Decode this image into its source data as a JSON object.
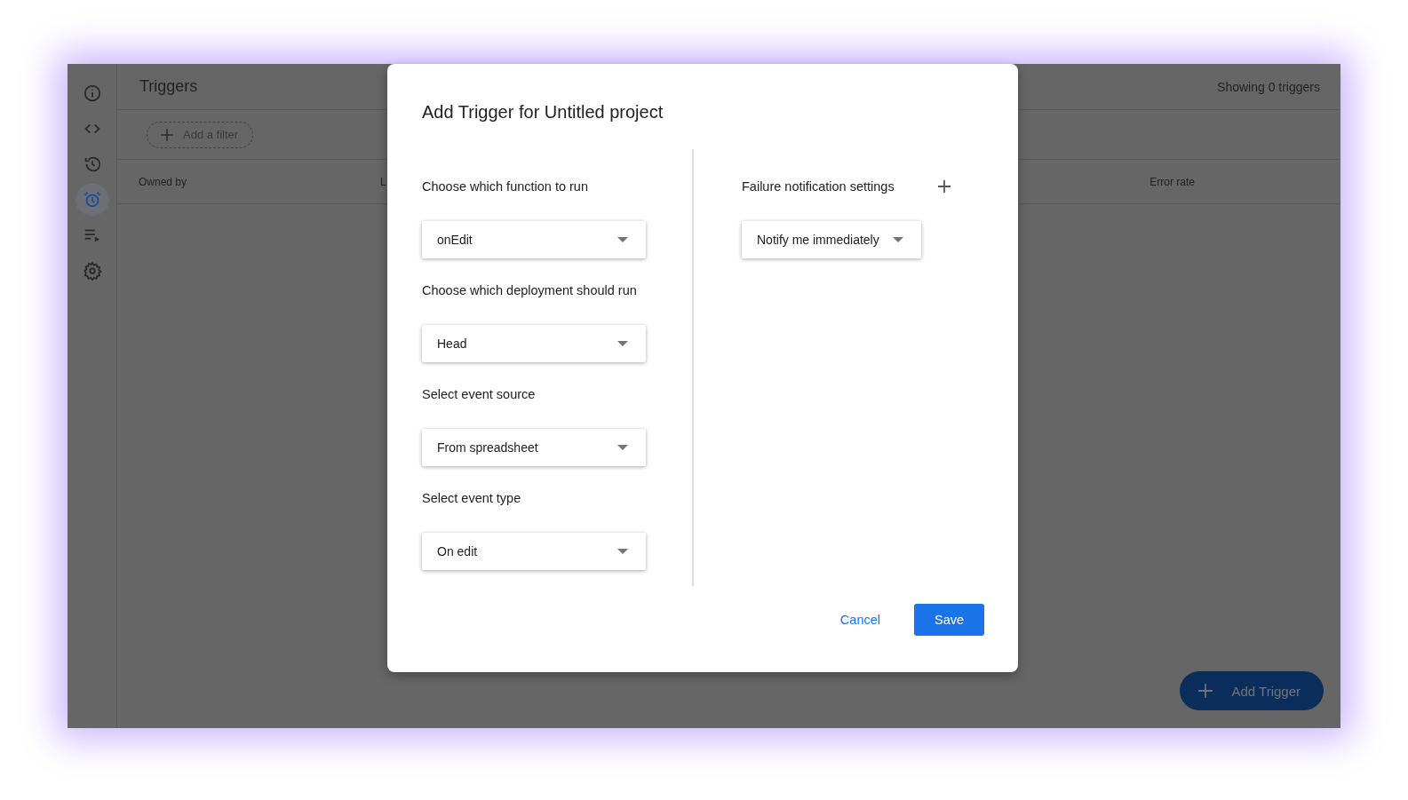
{
  "sidebar": {
    "items": [
      {
        "kind": "info",
        "selected": false
      },
      {
        "kind": "code",
        "selected": false
      },
      {
        "kind": "history",
        "selected": false
      },
      {
        "kind": "alarm",
        "selected": true
      },
      {
        "kind": "executions",
        "selected": false
      },
      {
        "kind": "settings",
        "selected": false
      }
    ]
  },
  "header": {
    "title": "Triggers",
    "count": "Showing 0 triggers"
  },
  "filter_button": "Add a filter",
  "table": {
    "columns": [
      "Owned by",
      "L",
      "Error rate"
    ]
  },
  "fab": "Add Trigger",
  "dialog": {
    "title": "Add Trigger for Untitled project",
    "fields": [
      {
        "label": "Choose which function to run",
        "value": "onEdit"
      },
      {
        "label": "Choose which deployment should run",
        "value": "Head"
      },
      {
        "label": "Select event source",
        "value": "From spreadsheet"
      },
      {
        "label": "Select event type",
        "value": "On edit"
      }
    ],
    "notification": {
      "label": "Failure notification settings",
      "value": "Notify me immediately"
    },
    "buttons": {
      "cancel": "Cancel",
      "save": "Save"
    }
  }
}
